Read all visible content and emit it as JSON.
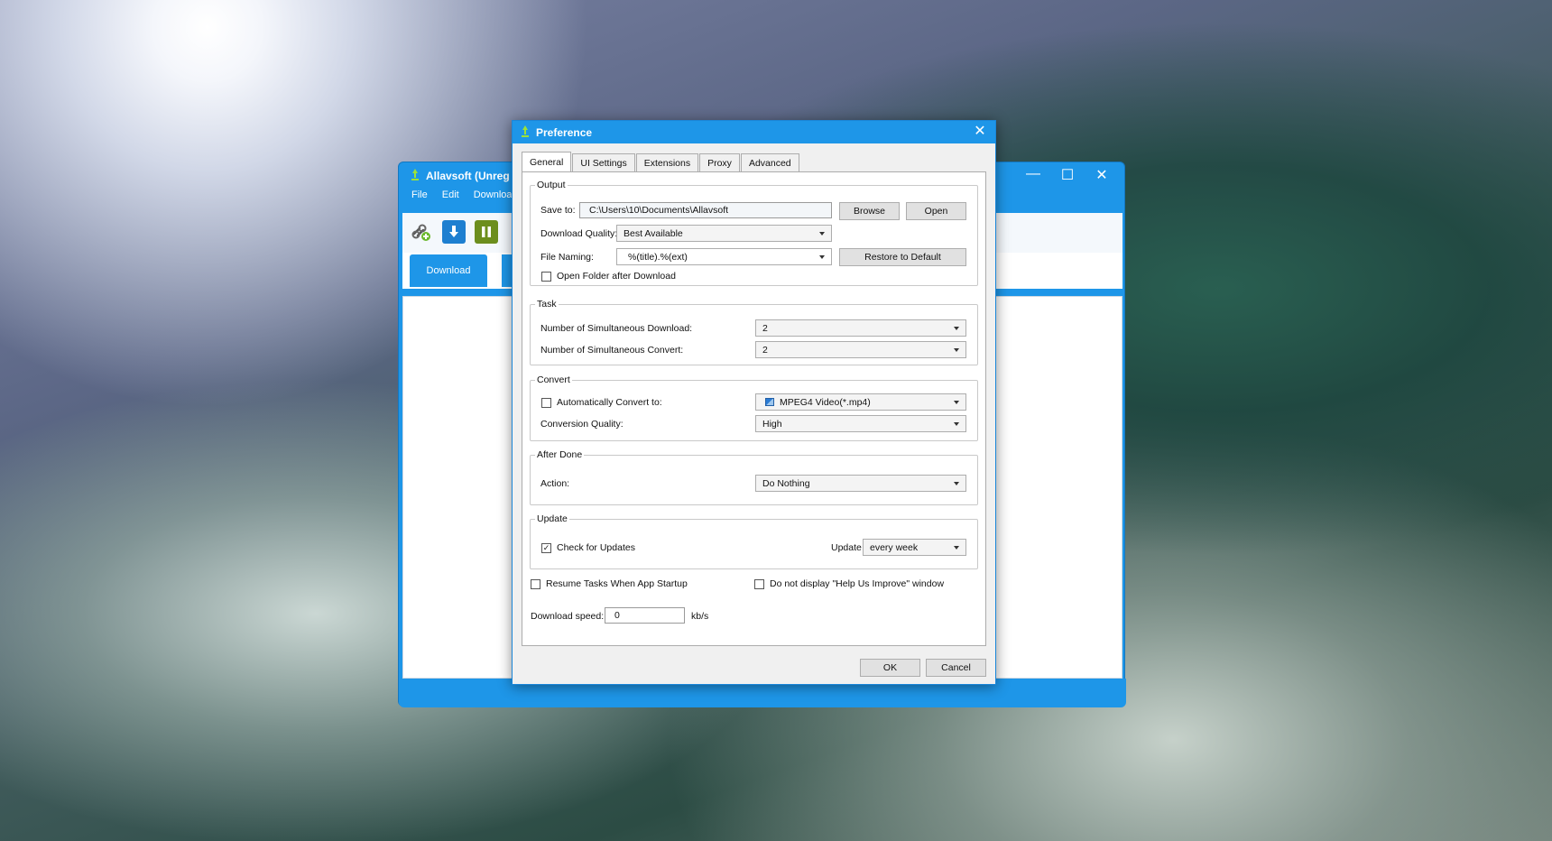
{
  "app": {
    "title": "Allavsoft (Unreg",
    "menu": [
      "File",
      "Edit",
      "Download"
    ],
    "window_controls": {
      "minimize": "—",
      "maximize": "☐",
      "close": "✕"
    },
    "active_tab": "Download"
  },
  "dialog": {
    "title": "Preference",
    "close_glyph": "✕",
    "tabs": [
      "General",
      "UI Settings",
      "Extensions",
      "Proxy",
      "Advanced"
    ],
    "output": {
      "legend": "Output",
      "save_to_label": "Save to:",
      "save_to_value": "C:\\Users\\10\\Documents\\Allavsoft",
      "browse_label": "Browse",
      "open_label": "Open",
      "quality_label": "Download Quality:",
      "quality_value": "Best Available",
      "naming_label": "File Naming:",
      "naming_value": "%(title).%(ext)",
      "restore_label": "Restore to Default",
      "open_folder_label": "Open Folder after Download",
      "open_folder_checked": false
    },
    "task": {
      "legend": "Task",
      "sim_download_label": "Number of Simultaneous Download:",
      "sim_download_value": "2",
      "sim_convert_label": "Number of Simultaneous Convert:",
      "sim_convert_value": "2"
    },
    "convert": {
      "legend": "Convert",
      "auto_convert_label": "Automatically Convert to:",
      "auto_convert_checked": false,
      "format_value": "MPEG4 Video(*.mp4)",
      "quality_label": "Conversion Quality:",
      "quality_value": "High"
    },
    "after_done": {
      "legend": "After Done",
      "action_label": "Action:",
      "action_value": "Do Nothing"
    },
    "update": {
      "legend": "Update",
      "check_label": "Check for Updates",
      "check_checked": true,
      "check_mark": "✓",
      "interval_label": "Update",
      "interval_value": "every week"
    },
    "resume_label": "Resume Tasks When App Startup",
    "resume_checked": false,
    "help_label": "Do not display \"Help Us Improve\" window",
    "help_checked": false,
    "speed_label": "Download speed:",
    "speed_value": "0",
    "speed_unit": "kb/s",
    "ok_label": "OK",
    "cancel_label": "Cancel"
  },
  "colors": {
    "title_bar": "#1e96e8",
    "window_border": "#1a86d9"
  }
}
